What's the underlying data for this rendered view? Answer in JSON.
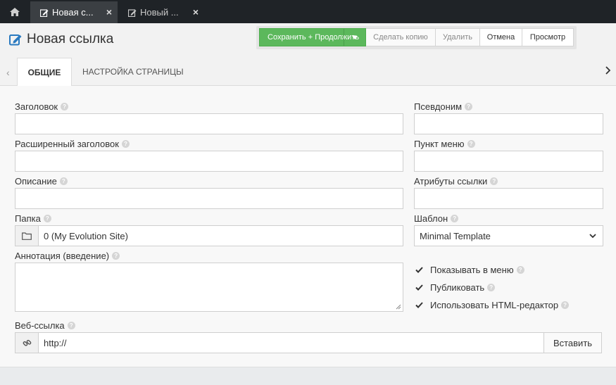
{
  "top_tabs": [
    {
      "label": "Новая с...",
      "icon": "edit-icon",
      "active": true
    },
    {
      "label": "Новый ...",
      "icon": "edit-icon",
      "active": false
    }
  ],
  "header": {
    "title": "Новая ссылка",
    "buttons": {
      "save": "Сохранить + Продолжить",
      "copy": "Сделать копию",
      "delete": "Удалить",
      "cancel": "Отмена",
      "preview": "Просмотр"
    }
  },
  "section_tabs": [
    "ОБЩИЕ",
    "НАСТРОЙКА СТРАНИЦЫ"
  ],
  "form": {
    "title_label": "Заголовок",
    "title_value": "",
    "alias_label": "Псевдоним",
    "alias_value": "",
    "long_title_label": "Расширенный заголовок",
    "long_title_value": "",
    "menu_item_label": "Пункт меню",
    "menu_item_value": "",
    "description_label": "Описание",
    "description_value": "",
    "link_attr_label": "Атрибуты ссылки",
    "link_attr_value": "",
    "folder_label": "Папка",
    "folder_value": "0 (My Evolution Site)",
    "template_label": "Шаблон",
    "template_value": "Minimal Template",
    "annotation_label": "Аннотация (введение)",
    "annotation_value": "",
    "checkboxes": [
      {
        "label": "Показывать в меню",
        "checked": true
      },
      {
        "label": "Публиковать",
        "checked": true
      },
      {
        "label": "Использовать HTML-редактор",
        "checked": true
      }
    ],
    "weblink_label": "Веб-ссылка",
    "weblink_value": "http://",
    "insert_button": "Вставить"
  },
  "colors": {
    "topbar": "#1f2327",
    "save_button": "#5cb85c",
    "title_icon": "#2a7ac0"
  }
}
